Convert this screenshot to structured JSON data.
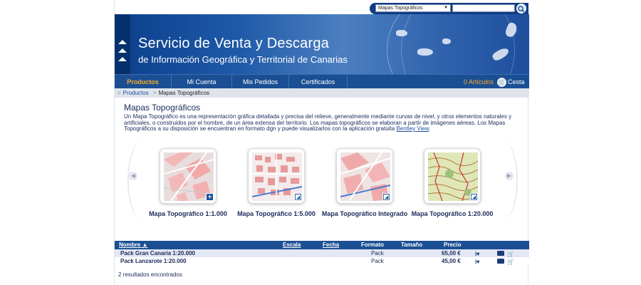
{
  "search": {
    "selected_option": "Mapas Topográficos",
    "input_value": ""
  },
  "banner": {
    "title": "Servicio de Venta y Descarga",
    "subtitle": "de Información Geográfica y Territorial de Canarias"
  },
  "nav": {
    "items": [
      {
        "label": "Productos",
        "active": true
      },
      {
        "label": "Mi Cuenta",
        "active": false
      },
      {
        "label": "Mis Pedidos",
        "active": false
      },
      {
        "label": "Certificados",
        "active": false
      }
    ],
    "cart_count": "0 Artículos",
    "cart_label": "Cesta"
  },
  "breadcrumb": {
    "items": [
      "Productos",
      "Mapas Topográficos"
    ]
  },
  "main": {
    "title": "Mapas Topográficos",
    "intro": "Un Mapa Topográfico es una representación gráfica detallada y precisa del relieve, generalmente mediante curvas de nivel, y otros elementos naturales y artificiales, o construidos por el hombre, de un área extensa del territorio. Los mapas topográficos se elaboran a partir de imágenes aéreas. Los Mapas Topográficos a su disposición se encuentran en formato dgn y puede visualizarlos con la aplicación gratuita",
    "intro_link": "Bentley View",
    "intro_end": "."
  },
  "carousel": {
    "items": [
      {
        "label": "Mapa Topográfico 1:1.000",
        "badge": "+"
      },
      {
        "label": "Mapa Topográfico 1:5.000",
        "badge": "◩"
      },
      {
        "label": "Mapa Topográfico Integrado",
        "badge": "◩"
      },
      {
        "label": "Mapa Topográfico 1:20.000",
        "badge": "◩"
      }
    ]
  },
  "table": {
    "headers": {
      "nombre": "Nombre ▲",
      "escala": "Escala",
      "fecha": "Fecha",
      "formato": "Formato",
      "tamano": "Tamaño",
      "precio": "Precio"
    },
    "rows": [
      {
        "nombre": "Pack Gran Canaria 1:20.000",
        "escala": "",
        "fecha": "",
        "formato": "Pack",
        "tamano": "",
        "precio": "65,00 €"
      },
      {
        "nombre": "Pack Lanzarote 1:20.000",
        "escala": "",
        "fecha": "",
        "formato": "Pack",
        "tamano": "",
        "precio": "45,00 €"
      }
    ],
    "result_count": "2 resultados encontrados"
  },
  "colors": {
    "nav_bg": "#1b4f94",
    "accent_orange": "#ffaa22",
    "text_dark_blue": "#1a2b5c"
  }
}
